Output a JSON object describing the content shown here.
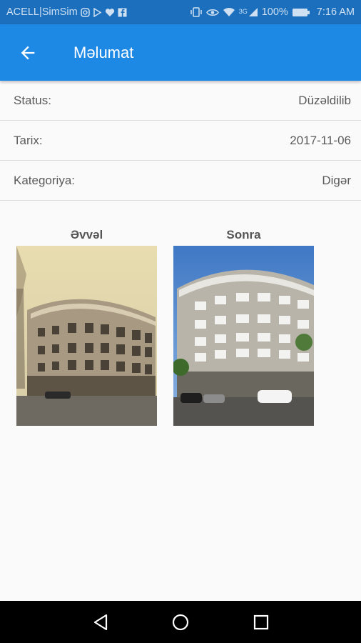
{
  "status_bar": {
    "carrier": "ACELL|SimSim",
    "battery": "100%",
    "time": "7:16 AM",
    "network": "3G",
    "icons": [
      "instagram-icon",
      "play-icon",
      "heart-icon",
      "facebook-icon",
      "vibrate-icon",
      "eye-icon",
      "wifi-icon",
      "signal-icon",
      "battery-icon"
    ]
  },
  "app_bar": {
    "title": "Məlumat",
    "back_icon": "arrow-left-icon",
    "color": "#1e88e5"
  },
  "details": [
    {
      "label": "Status:",
      "value": "Düzəldilib"
    },
    {
      "label": "Tarix:",
      "value": "2017-11-06"
    },
    {
      "label": "Kategoriya:",
      "value": "Digər"
    }
  ],
  "photos": {
    "before_label": "Əvvəl",
    "after_label": "Sonra"
  },
  "nav_bar": {
    "icons": [
      "back-triangle-icon",
      "home-circle-icon",
      "recents-square-icon"
    ]
  }
}
